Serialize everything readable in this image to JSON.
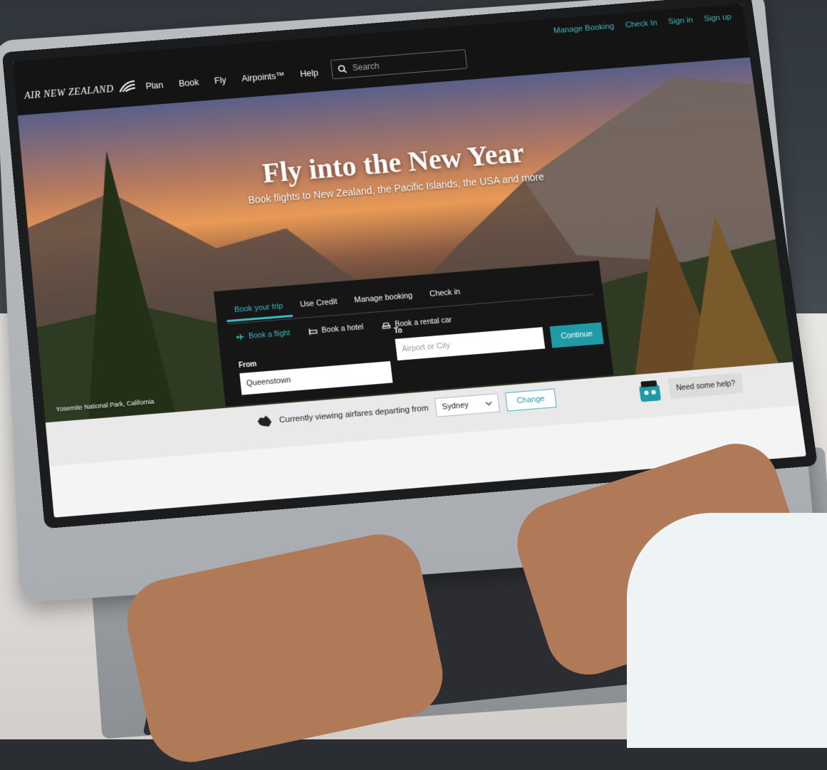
{
  "header": {
    "logo_text": "AIR NEW ZEALAND",
    "nav": [
      "Plan",
      "Book",
      "Fly",
      "Airpoints™",
      "Help"
    ],
    "search_placeholder": "Search",
    "utility": [
      "Manage Booking",
      "Check In",
      "Sign in",
      "Sign up"
    ]
  },
  "hero": {
    "title": "Fly into the New Year",
    "subtitle": "Book flights to New Zealand, the Pacific Islands, the USA and more",
    "photo_caption": "Yosemite National Park, California"
  },
  "booking": {
    "tabs": [
      "Book your trip",
      "Use Credit",
      "Manage booking",
      "Check in"
    ],
    "active_tab": "Book your trip",
    "subtypes": [
      "Book a flight",
      "Book a hotel",
      "Book a rental car"
    ],
    "from_label": "From",
    "from_value": "Queenstown",
    "to_label": "To",
    "to_placeholder": "Airport or City",
    "continue_label": "Continue"
  },
  "airfare_bar": {
    "text": "Currently viewing airfares departing from",
    "selected_city": "Sydney",
    "change_label": "Change"
  },
  "help": {
    "label": "Need some help?"
  },
  "colors": {
    "accent": "#3fb8c3",
    "button": "#1f9aa7",
    "dark": "#141414"
  }
}
